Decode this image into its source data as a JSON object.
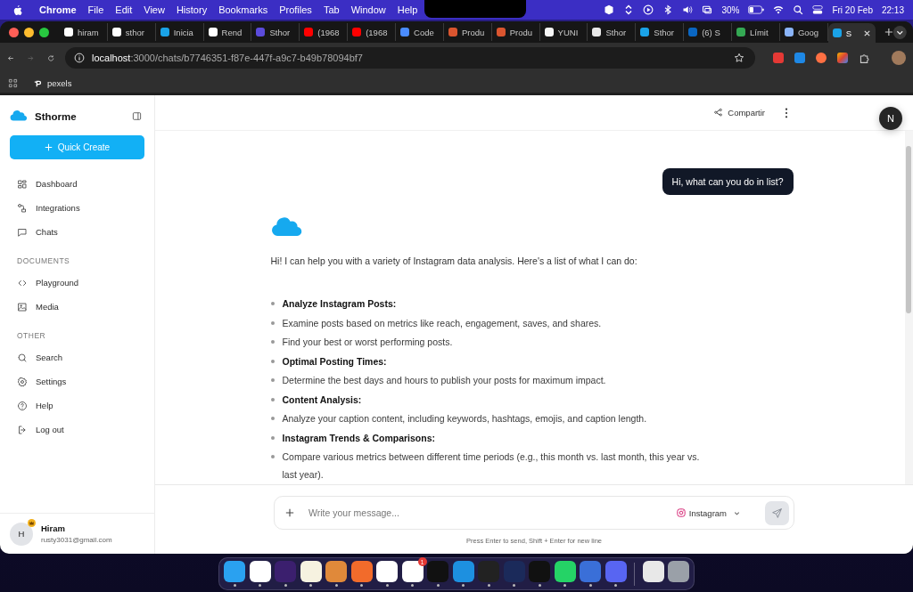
{
  "menu_bar": {
    "app": "Chrome",
    "menus": [
      "File",
      "Edit",
      "View",
      "History",
      "Bookmarks",
      "Profiles",
      "Tab",
      "Window",
      "Help"
    ],
    "battery": "30%",
    "date": "Fri 20 Feb",
    "time": "22:13"
  },
  "browser": {
    "tabs": [
      {
        "title": "hiram",
        "color": "#ffffff",
        "selected": false
      },
      {
        "title": "sthor",
        "color": "#ffffff",
        "selected": false
      },
      {
        "title": "Inicia",
        "color": "#1aa3e8",
        "selected": false
      },
      {
        "title": "Rend",
        "color": "#ffffff",
        "selected": false
      },
      {
        "title": "Sthor",
        "color": "#5b4bdb",
        "selected": false
      },
      {
        "title": "(1968",
        "color": "#ff0000",
        "selected": false
      },
      {
        "title": "(1968",
        "color": "#ff0000",
        "selected": false
      },
      {
        "title": "Code",
        "color": "#4a8cff",
        "selected": false
      },
      {
        "title": "Produ",
        "color": "#da552f",
        "selected": false
      },
      {
        "title": "Produ",
        "color": "#da552f",
        "selected": false
      },
      {
        "title": "YUNI",
        "color": "#f5f5f5",
        "selected": false
      },
      {
        "title": "Sthor",
        "color": "#e8e8e8",
        "selected": false
      },
      {
        "title": "Sthor",
        "color": "#1aa3e8",
        "selected": false
      },
      {
        "title": "(6) S",
        "color": "#0a66c2",
        "selected": false
      },
      {
        "title": "Límit",
        "color": "#34a853",
        "selected": false
      },
      {
        "title": "Goog",
        "color": "#8ab4f8",
        "selected": false
      },
      {
        "title": "S",
        "color": "#1aa3e8",
        "selected": true
      }
    ],
    "url_host": "localhost",
    "url_rest": ":3000/chats/b7746351-f87e-447f-a9c7-b49b78094bf7",
    "bookmarks": [
      "pexels"
    ]
  },
  "sidebar": {
    "brand": "Sthorme",
    "quick_create": "Quick Create",
    "sections": [
      {
        "items": [
          "Dashboard",
          "Integrations",
          "Chats"
        ]
      },
      {
        "heading": "DOCUMENTS",
        "items": [
          "Playground",
          "Media"
        ]
      },
      {
        "heading": "OTHER",
        "items": [
          "Search",
          "Settings",
          "Help",
          "Log out"
        ]
      }
    ],
    "user": {
      "initial": "H",
      "name": "Hiram",
      "email": "rusty3031@gmail.com"
    }
  },
  "header": {
    "share": "Compartir",
    "dev_badge": "N"
  },
  "chat": {
    "user_message": "Hi, what can you do in list?",
    "intro": "Hi! I can help you with a variety of Instagram data analysis. Here's a list of what I can do:",
    "items": [
      {
        "kind": "heading",
        "text": "Analyze Instagram Posts:"
      },
      {
        "kind": "detail",
        "text": "Examine posts based on metrics like reach, engagement, saves, and shares."
      },
      {
        "kind": "detail",
        "text": "Find your best or worst performing posts."
      },
      {
        "kind": "heading",
        "text": "Optimal Posting Times:"
      },
      {
        "kind": "detail",
        "text": "Determine the best days and hours to publish your posts for maximum impact."
      },
      {
        "kind": "heading",
        "text": "Content Analysis:"
      },
      {
        "kind": "detail",
        "text": "Analyze your caption content, including keywords, hashtags, emojis, and caption length."
      },
      {
        "kind": "heading",
        "text": "Instagram Trends & Comparisons:"
      },
      {
        "kind": "detail",
        "text": "Compare various metrics between different time periods (e.g., this month vs. last month, this year vs. last year)."
      }
    ]
  },
  "composer": {
    "placeholder": "Write your message...",
    "source": "Instagram",
    "hint": "Press Enter to send, Shift + Enter for new line"
  },
  "dock": {
    "apps": [
      {
        "running": true
      },
      {
        "running": true
      },
      {
        "running": true
      },
      {
        "running": true
      },
      {
        "running": true
      },
      {
        "running": true
      },
      {
        "running": true
      },
      {
        "running": true,
        "badge": "1"
      },
      {
        "running": true
      },
      {
        "running": true
      },
      {
        "running": true
      },
      {
        "running": true
      },
      {
        "running": true
      },
      {
        "running": true
      },
      {
        "running": true
      },
      {
        "running": true
      },
      {
        "running": false
      },
      {
        "running": false
      }
    ]
  }
}
